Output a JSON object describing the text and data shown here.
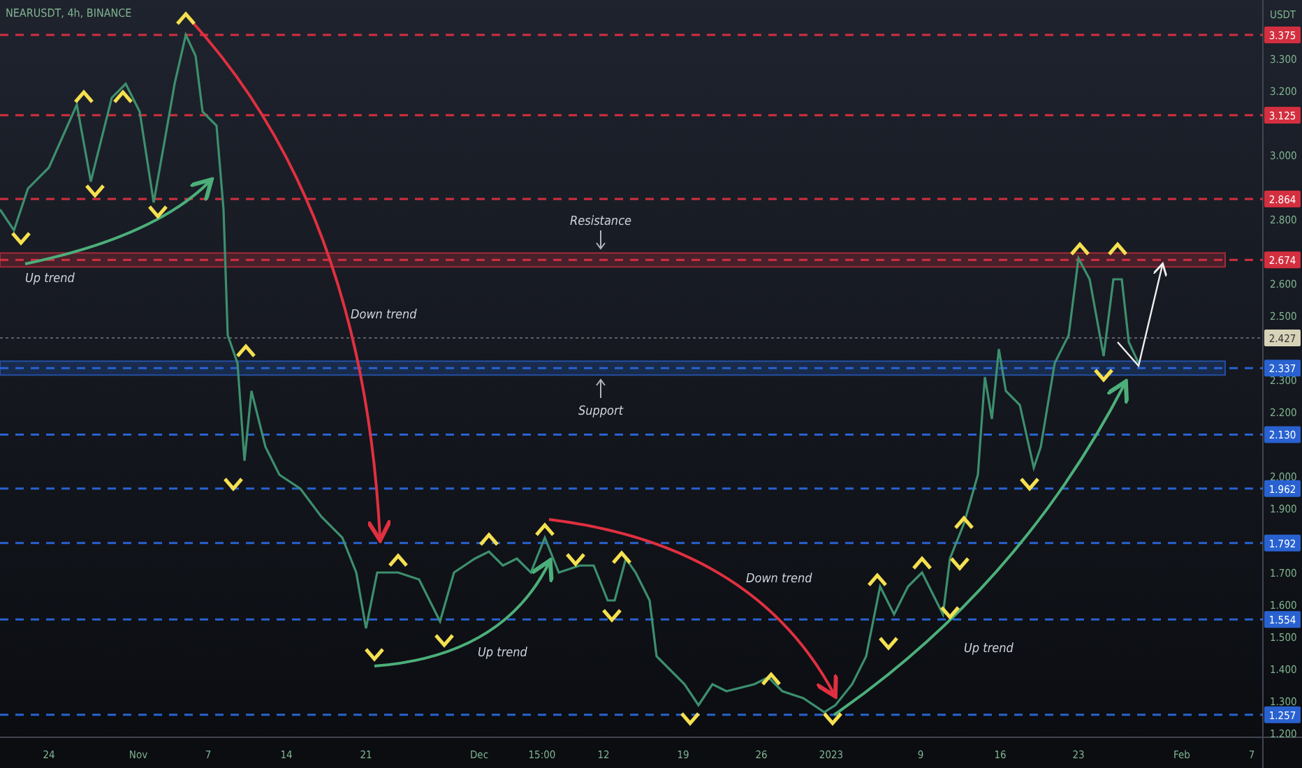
{
  "header": {
    "symbol": "NEARUSDT, 4h, BINANCE",
    "currency": "USDT"
  },
  "price_axis": {
    "ticks": [
      "3.300",
      "3.200",
      "3.000",
      "2.800",
      "2.600",
      "2.500",
      "2.300",
      "2.200",
      "2.000",
      "1.900",
      "1.700",
      "1.600",
      "1.500",
      "1.400",
      "1.300",
      "1.200"
    ],
    "levels": [
      {
        "label": "3.375",
        "color": "#d32f3f",
        "zone": false
      },
      {
        "label": "3.125",
        "color": "#d32f3f",
        "zone": false
      },
      {
        "label": "2.864",
        "color": "#d32f3f",
        "zone": false
      },
      {
        "label": "2.674",
        "color": "#d32f3f",
        "zone": true
      },
      {
        "label": "2.337",
        "color": "#2962d0",
        "zone": true
      },
      {
        "label": "2.130",
        "color": "#2962d0",
        "zone": false
      },
      {
        "label": "1.962",
        "color": "#2962d0",
        "zone": false
      },
      {
        "label": "1.792",
        "color": "#2962d0",
        "zone": false
      },
      {
        "label": "1.554",
        "color": "#2962d0",
        "zone": false
      },
      {
        "label": "1.257",
        "color": "#2962d0",
        "zone": false
      }
    ],
    "current_price": "2.427"
  },
  "annotations": [
    "Resistance",
    "Support",
    "Up trend",
    "Down trend",
    "Up trend",
    "Down trend",
    "Up trend"
  ],
  "time_axis": {
    "labels": [
      "24",
      "Nov",
      "7",
      "14",
      "21",
      "Dec",
      "15:00",
      "12",
      "19",
      "26",
      "2023",
      "9",
      "16",
      "23",
      "Feb",
      "7"
    ]
  }
}
